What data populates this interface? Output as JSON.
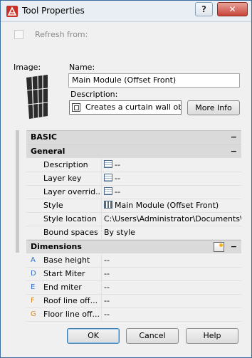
{
  "window": {
    "title": "Tool Properties",
    "help_label": "?",
    "close_label": "✕"
  },
  "refresh": {
    "label": "Refresh from:",
    "checked": false
  },
  "image_label": "Image:",
  "name": {
    "label": "Name:",
    "value": "Main Module (Offset Front)"
  },
  "description": {
    "label": "Description:",
    "value": "Creates a curtain wall obj"
  },
  "more_info_label": "More Info",
  "grid": {
    "basic": {
      "title": "BASIC",
      "collapse": "−"
    },
    "general": {
      "title": "General",
      "collapse": "−",
      "rows": [
        {
          "name": "Description",
          "value": "--",
          "icon": "list-icon"
        },
        {
          "name": "Layer key",
          "value": "--",
          "icon": "list-icon"
        },
        {
          "name": "Layer overrid...",
          "value": "--",
          "icon": "list-icon"
        },
        {
          "name": "Style",
          "value": "Main Module (Offset Front)",
          "icon": "style-icon"
        },
        {
          "name": "Style location",
          "value": "C:\\Users\\Administrator\\Documents\\A...",
          "icon": ""
        },
        {
          "name": "Bound spaces",
          "value": "By style",
          "icon": ""
        }
      ]
    },
    "dimensions": {
      "title": "Dimensions",
      "collapse": "−",
      "rows": [
        {
          "letter": "A",
          "name": "Base height",
          "value": "--"
        },
        {
          "letter": "D",
          "name": "Start Miter",
          "value": "--"
        },
        {
          "letter": "E",
          "name": "End miter",
          "value": "--"
        },
        {
          "letter": "F",
          "name": "Roof line off...",
          "value": "--"
        },
        {
          "letter": "G",
          "name": "Floor line off...",
          "value": "--"
        }
      ]
    }
  },
  "buttons": {
    "ok": "OK",
    "cancel": "Cancel",
    "help": "Help"
  },
  "colors": {
    "accent": "#2f6fd1",
    "header_bg": "#dadada",
    "close_red": "#c8453a"
  }
}
